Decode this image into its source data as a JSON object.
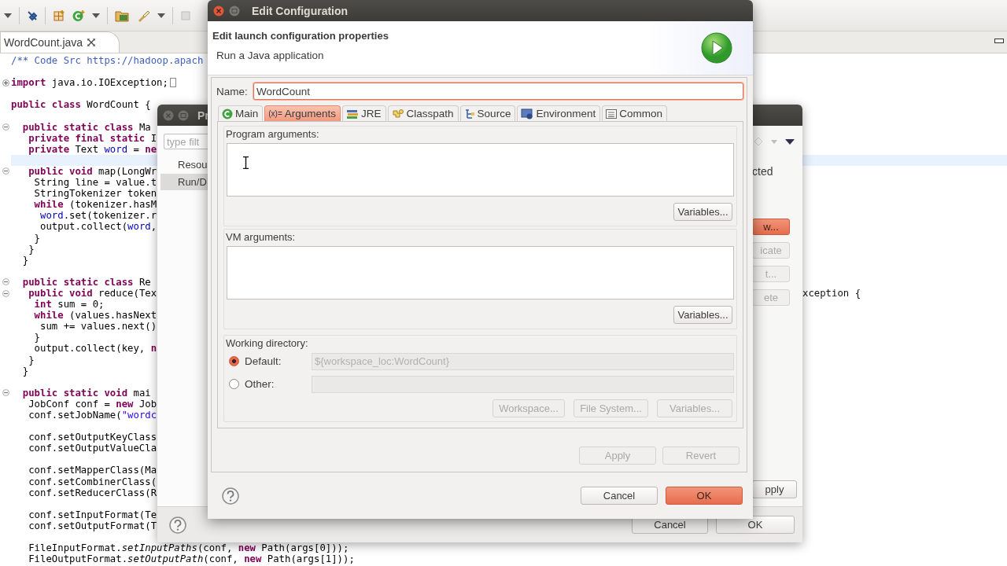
{
  "editor": {
    "tab": {
      "label": "WordCount.java"
    },
    "lines": [
      {
        "current": false,
        "segments": [
          {
            "kind": "comment",
            "text": "/** Code Src https://hadoop.apach"
          }
        ]
      },
      {
        "current": false
      },
      {
        "current": false,
        "expanded": false,
        "segments": [
          {
            "kind": "keyword",
            "text": "import"
          },
          {
            "kind": "plain",
            "text": " java.io.IOException;"
          }
        ]
      },
      {
        "current": false
      },
      {
        "current": false,
        "segments": [
          {
            "kind": "keyword",
            "text": "public class"
          },
          {
            "kind": "plain",
            "text": " WordCount {"
          }
        ]
      },
      {
        "current": false
      },
      {
        "current": false,
        "expanded": true,
        "segments": [
          {
            "kind": "keyword",
            "text": "  public static class"
          },
          {
            "kind": "plain",
            "text": " Ma"
          }
        ]
      },
      {
        "current": false,
        "segments": [
          {
            "kind": "keyword",
            "text": "   private final static"
          },
          {
            "kind": "plain",
            "text": " I"
          }
        ]
      },
      {
        "current": false,
        "segments": [
          {
            "kind": "keyword",
            "text": "   private"
          },
          {
            "kind": "plain",
            "text": " Text "
          },
          {
            "kind": "field",
            "text": "word"
          },
          {
            "kind": "plain",
            "text": " = "
          },
          {
            "kind": "keyword",
            "text": "ne"
          }
        ]
      },
      {
        "current": true
      },
      {
        "current": false,
        "expanded": true,
        "segments": [
          {
            "kind": "keyword",
            "text": "   public void"
          },
          {
            "kind": "plain",
            "text": " map(LongWr"
          }
        ]
      },
      {
        "current": false,
        "segments": [
          {
            "kind": "plain",
            "text": "    String line = value.t"
          }
        ]
      },
      {
        "current": false,
        "segments": [
          {
            "kind": "plain",
            "text": "    StringTokenizer token"
          }
        ]
      },
      {
        "current": false,
        "segments": [
          {
            "kind": "keyword",
            "text": "    while"
          },
          {
            "kind": "plain",
            "text": " (tokenizer.hasM"
          }
        ]
      },
      {
        "current": false,
        "segments": [
          {
            "kind": "field",
            "text": "     word"
          },
          {
            "kind": "plain",
            "text": ".set(tokenizer.r"
          }
        ]
      },
      {
        "current": false,
        "segments": [
          {
            "kind": "plain",
            "text": "     output.collect("
          },
          {
            "kind": "field",
            "text": "word"
          },
          {
            "kind": "plain",
            "text": ","
          }
        ]
      },
      {
        "current": false,
        "segments": [
          {
            "kind": "plain",
            "text": "    }"
          }
        ]
      },
      {
        "current": false,
        "segments": [
          {
            "kind": "plain",
            "text": "   }"
          }
        ]
      },
      {
        "current": false,
        "segments": [
          {
            "kind": "plain",
            "text": "  }"
          }
        ]
      },
      {
        "current": false
      },
      {
        "current": false,
        "expanded": true,
        "segments": [
          {
            "kind": "keyword",
            "text": "  public static class"
          },
          {
            "kind": "plain",
            "text": " Re"
          }
        ]
      },
      {
        "current": false,
        "expanded": true,
        "segments": [
          {
            "kind": "keyword",
            "text": "   public void"
          },
          {
            "kind": "plain",
            "text": " reduce(Tex"
          }
        ],
        "right_text": "xception {"
      },
      {
        "current": false,
        "segments": [
          {
            "kind": "keyword",
            "text": "    int"
          },
          {
            "kind": "plain",
            "text": " sum = 0;"
          }
        ]
      },
      {
        "current": false,
        "segments": [
          {
            "kind": "keyword",
            "text": "    while"
          },
          {
            "kind": "plain",
            "text": " (values.hasNext"
          }
        ]
      },
      {
        "current": false,
        "segments": [
          {
            "kind": "plain",
            "text": "     sum += values.next()"
          }
        ]
      },
      {
        "current": false,
        "segments": [
          {
            "kind": "plain",
            "text": "    }"
          }
        ]
      },
      {
        "current": false,
        "segments": [
          {
            "kind": "plain",
            "text": "    output.collect(key, "
          },
          {
            "kind": "keyword",
            "text": "n"
          }
        ]
      },
      {
        "current": false,
        "segments": [
          {
            "kind": "plain",
            "text": "   }"
          }
        ]
      },
      {
        "current": false,
        "segments": [
          {
            "kind": "plain",
            "text": "  }"
          }
        ]
      },
      {
        "current": false
      },
      {
        "current": false,
        "expanded": true,
        "segments": [
          {
            "kind": "keyword",
            "text": "  public static void"
          },
          {
            "kind": "plain",
            "text": " mai"
          }
        ]
      },
      {
        "current": false,
        "segments": [
          {
            "kind": "plain",
            "text": "   JobConf conf = "
          },
          {
            "kind": "keyword",
            "text": "new"
          },
          {
            "kind": "plain",
            "text": " Job"
          }
        ]
      },
      {
        "current": false,
        "segments": [
          {
            "kind": "plain",
            "text": "   conf.setJobName("
          },
          {
            "kind": "string",
            "text": "\"wordc"
          }
        ]
      },
      {
        "current": false
      },
      {
        "current": false,
        "segments": [
          {
            "kind": "plain",
            "text": "   conf.setOutputKeyClass"
          }
        ]
      },
      {
        "current": false,
        "segments": [
          {
            "kind": "plain",
            "text": "   conf.setOutputValueCla"
          }
        ]
      },
      {
        "current": false
      },
      {
        "current": false,
        "segments": [
          {
            "kind": "plain",
            "text": "   conf.setMapperClass(Ma"
          }
        ]
      },
      {
        "current": false,
        "segments": [
          {
            "kind": "plain",
            "text": "   conf.setCombinerClass("
          }
        ]
      },
      {
        "current": false,
        "segments": [
          {
            "kind": "plain",
            "text": "   conf.setReducerClass(R"
          }
        ]
      },
      {
        "current": false
      },
      {
        "current": false,
        "segments": [
          {
            "kind": "plain",
            "text": "   conf.setInputFormat(Te"
          }
        ]
      },
      {
        "current": false,
        "segments": [
          {
            "kind": "plain",
            "text": "   conf.setOutputFormat(T"
          }
        ]
      },
      {
        "current": false
      },
      {
        "current": false,
        "segments": [
          {
            "kind": "plain",
            "text": "   FileInputFormat."
          },
          {
            "kind": "method",
            "text": "setInputPaths"
          },
          {
            "kind": "plain",
            "text": "(conf, "
          },
          {
            "kind": "keyword",
            "text": "new"
          },
          {
            "kind": "plain",
            "text": " Path(args[0]));"
          }
        ]
      },
      {
        "current": false,
        "segments": [
          {
            "kind": "plain",
            "text": "   FileOutputFormat."
          },
          {
            "kind": "method",
            "text": "setOutputPath"
          },
          {
            "kind": "plain",
            "text": "(conf, "
          },
          {
            "kind": "keyword",
            "text": "new"
          },
          {
            "kind": "plain",
            "text": " Path(args[1]));"
          }
        ]
      }
    ]
  },
  "preferences_dialog": {
    "title": "Pr",
    "filter": {
      "placeholder": "type filt"
    },
    "items": [
      {
        "label": "Resou",
        "selected": false
      },
      {
        "label": "Run/D",
        "selected": true
      }
    ],
    "header_fragment": "cted",
    "side_buttons": [
      {
        "label": "w...",
        "default": true,
        "disabled": false
      },
      {
        "label": "icate",
        "default": false,
        "disabled": true
      },
      {
        "label": "t...",
        "default": false,
        "disabled": true
      },
      {
        "label": "ete",
        "default": false,
        "disabled": true
      }
    ],
    "apply_button": {
      "label": "pply",
      "disabled": false
    },
    "buttons": [
      {
        "label": "Cancel",
        "default": false
      },
      {
        "label": "OK",
        "default": false
      }
    ]
  },
  "dialog": {
    "title": "Edit Configuration",
    "header_title": "Edit launch configuration properties",
    "header_subtitle": "Run a Java application",
    "name": {
      "label": "Name:",
      "value": "WordCount",
      "focused": true
    },
    "tabs": [
      {
        "kind": "main",
        "label": "Main",
        "selected": false
      },
      {
        "kind": "arguments",
        "icon_text": "(x)=",
        "label": "Arguments",
        "selected": true
      },
      {
        "kind": "jre",
        "label": "JRE",
        "selected": false
      },
      {
        "kind": "classpath",
        "label": "Classpath",
        "selected": false
      },
      {
        "kind": "source",
        "label": "Source",
        "selected": false
      },
      {
        "kind": "environment",
        "label": "Environment",
        "selected": false
      },
      {
        "kind": "common",
        "label": "Common",
        "selected": false
      }
    ],
    "program_arguments": {
      "label": "Program arguments:",
      "button": "Variables..."
    },
    "vm_arguments": {
      "label": "VM arguments:",
      "button": "Variables..."
    },
    "working_directory": {
      "label": "Working directory:",
      "options": [
        {
          "label": "Default:",
          "selected": true,
          "value": "${workspace_loc:WordCount}",
          "field_disabled": true
        },
        {
          "label": "Other:",
          "selected": false,
          "field_disabled": true
        }
      ],
      "buttons": [
        {
          "label": "Workspace...",
          "disabled": true
        },
        {
          "label": "File System...",
          "disabled": true
        },
        {
          "label": "Variables...",
          "disabled": true
        }
      ]
    },
    "apply_buttons": [
      {
        "label": "Apply",
        "disabled": true
      },
      {
        "label": "Revert",
        "disabled": true
      }
    ],
    "buttons": [
      {
        "label": "Cancel",
        "default": false
      },
      {
        "label": "OK",
        "default": true
      }
    ]
  }
}
